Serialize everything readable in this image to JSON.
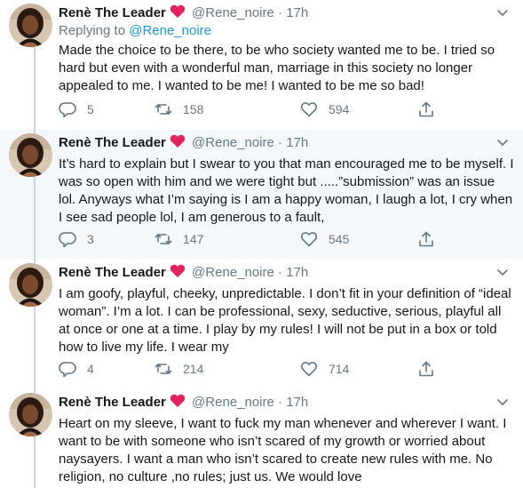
{
  "colors": {
    "text": "#14171a",
    "secondary": "#657786",
    "link": "#1b95e0",
    "heart": "#e0245e",
    "hover_row": "#f5f8fa"
  },
  "tweets": [
    {
      "name": "Renè The Leader",
      "handle": "@Rene_noire",
      "dot": "·",
      "time": "17h",
      "replying_prefix": "Replying to",
      "replying_to": "@Rene_noire",
      "text": "Made the choice to be there, to be who society wanted me to be.  I tried so hard but even with a wonderful man, marriage in this society no longer appealed to me. I wanted to be me! I wanted to be me so bad!",
      "replies": "5",
      "retweets": "158",
      "likes": "594"
    },
    {
      "name": "Renè The Leader",
      "handle": "@Rene_noire",
      "dot": "·",
      "time": "17h",
      "text": "It’s hard to explain but I swear to you that man encouraged me to be myself. I was so open with him and we were tight but .....”submission” was an issue lol.  Anyways what I’m saying is I am a happy woman, I laugh a lot, I cry when I see sad people lol, I am generous to a fault,",
      "replies": "3",
      "retweets": "147",
      "likes": "545"
    },
    {
      "name": "Renè The Leader",
      "handle": "@Rene_noire",
      "dot": "·",
      "time": "17h",
      "text": "I am goofy, playful, cheeky, unpredictable. I don’t fit in your definition of “ideal woman”. I’m a lot. I can be professional, sexy, seductive, serious, playful all at once or one at a time. I play by my rules! I will not be put in a box or told how to live my life. I wear my",
      "replies": "4",
      "retweets": "214",
      "likes": "714"
    },
    {
      "name": "Renè The Leader",
      "handle": "@Rene_noire",
      "dot": "·",
      "time": "17h",
      "text": "Heart on my sleeve, I want to fuck my man whenever and wherever I want. I want to be with someone who isn’t scared of my growth or worried about naysayers. I want a man who isn’t scared to create new rules with me. No religion, no culture ,no rules; just us. We would love"
    }
  ]
}
